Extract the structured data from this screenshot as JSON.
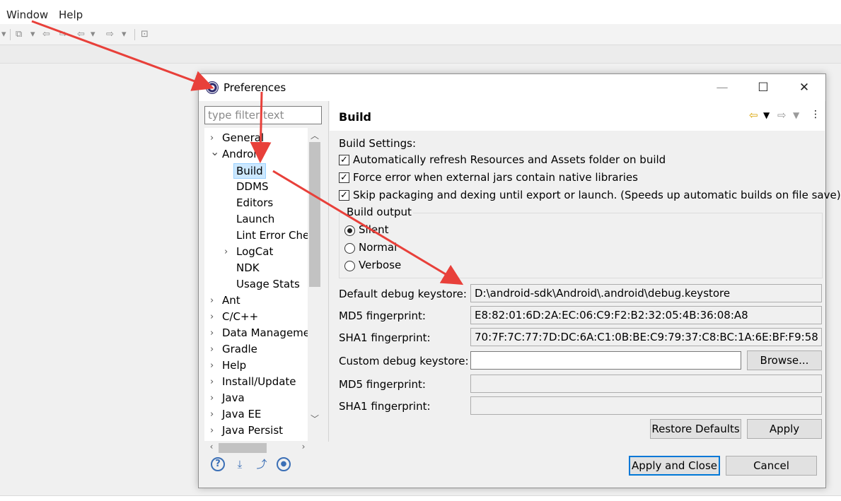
{
  "menubar": {
    "items": [
      "Window",
      "Help"
    ]
  },
  "dialog": {
    "title": "Preferences",
    "filter_placeholder": "type filter text",
    "tree": [
      {
        "label": "General",
        "level": 0,
        "expander": "collapsed"
      },
      {
        "label": "Android",
        "level": 0,
        "expander": "expanded"
      },
      {
        "label": "Build",
        "level": 1,
        "expander": "none",
        "selected": true
      },
      {
        "label": "DDMS",
        "level": 1,
        "expander": "none"
      },
      {
        "label": "Editors",
        "level": 1,
        "expander": "none"
      },
      {
        "label": "Launch",
        "level": 1,
        "expander": "none"
      },
      {
        "label": "Lint Error Che",
        "level": 1,
        "expander": "none"
      },
      {
        "label": "LogCat",
        "level": 1,
        "expander": "collapsed"
      },
      {
        "label": "NDK",
        "level": 1,
        "expander": "none"
      },
      {
        "label": "Usage Stats",
        "level": 1,
        "expander": "none"
      },
      {
        "label": "Ant",
        "level": 0,
        "expander": "collapsed"
      },
      {
        "label": "C/C++",
        "level": 0,
        "expander": "collapsed"
      },
      {
        "label": "Data Manageme",
        "level": 0,
        "expander": "collapsed"
      },
      {
        "label": "Gradle",
        "level": 0,
        "expander": "collapsed"
      },
      {
        "label": "Help",
        "level": 0,
        "expander": "collapsed"
      },
      {
        "label": "Install/Update",
        "level": 0,
        "expander": "collapsed"
      },
      {
        "label": "Java",
        "level": 0,
        "expander": "collapsed"
      },
      {
        "label": "Java EE",
        "level": 0,
        "expander": "collapsed"
      },
      {
        "label": "Java Persist",
        "level": 0,
        "expander": "collapsed"
      }
    ],
    "page": {
      "title": "Build",
      "build_settings_label": "Build Settings:",
      "checkboxes": [
        {
          "label": "Automatically refresh Resources and Assets folder on build",
          "checked": true
        },
        {
          "label": "Force error when external jars contain native libraries",
          "checked": true
        },
        {
          "label": "Skip packaging and dexing until export or launch. (Speeds up automatic builds on file save)",
          "checked": true
        }
      ],
      "build_output": {
        "label": "Build output",
        "options": [
          {
            "label": "Silent",
            "selected": true
          },
          {
            "label": "Normal",
            "selected": false
          },
          {
            "label": "Verbose",
            "selected": false
          }
        ]
      },
      "default_keystore": {
        "label": "Default debug keystore:",
        "value": "D:\\android-sdk\\Android\\.android\\debug.keystore",
        "md5_label": "MD5 fingerprint:",
        "md5_value": "E8:82:01:6D:2A:EC:06:C9:F2:B2:32:05:4B:36:08:A8",
        "sha1_label": "SHA1 fingerprint:",
        "sha1_value": "70:7F:7C:77:7D:DC:6A:C1:0B:BE:C9:79:37:C8:BC:1A:6E:BF:F9:58"
      },
      "custom_keystore": {
        "label": "Custom debug keystore:",
        "value": "",
        "browse_label": "Browse...",
        "md5_label": "MD5 fingerprint:",
        "md5_value": "",
        "sha1_label": "SHA1 fingerprint:",
        "sha1_value": ""
      },
      "restore_defaults_label": "Restore Defaults",
      "apply_label": "Apply"
    },
    "footer": {
      "apply_close_label": "Apply and Close",
      "cancel_label": "Cancel"
    }
  },
  "colors": {
    "annotation_arrow": "#e8403a",
    "selection": "#cce8ff",
    "default_button_border": "#0078d7"
  }
}
